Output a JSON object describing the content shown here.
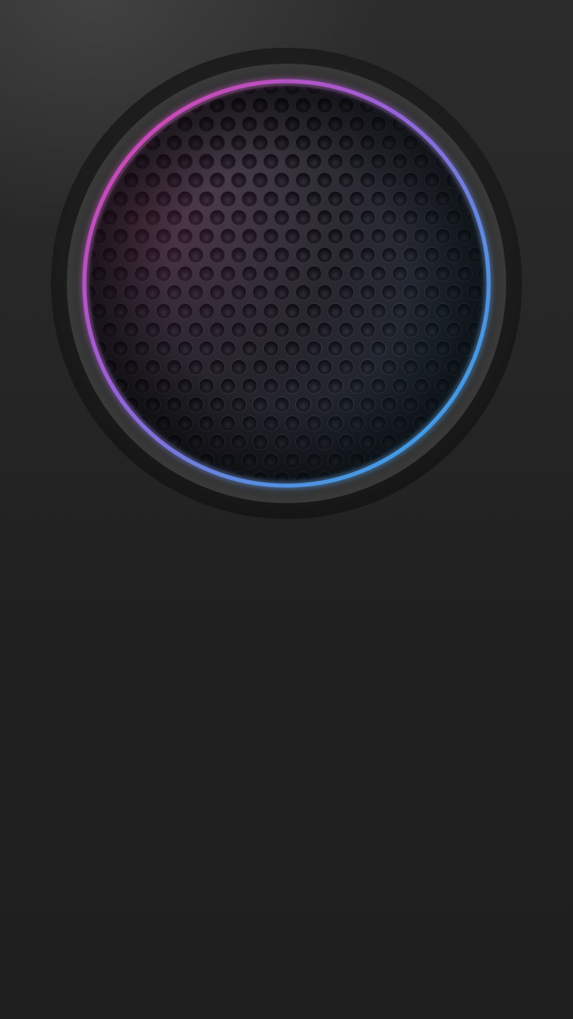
{
  "speaker": {
    "ring_gradient": [
      "#e23fa6",
      "#9b5fd6",
      "#5a8de0",
      "#2ea5e6"
    ],
    "outer_bezel_color": "#1a1a1a",
    "grille_color": "#232323",
    "hole_color": "#0e0e0e"
  },
  "background": {
    "top_color": "#2c2c2c",
    "bottom_color": "#1f1f1f"
  }
}
